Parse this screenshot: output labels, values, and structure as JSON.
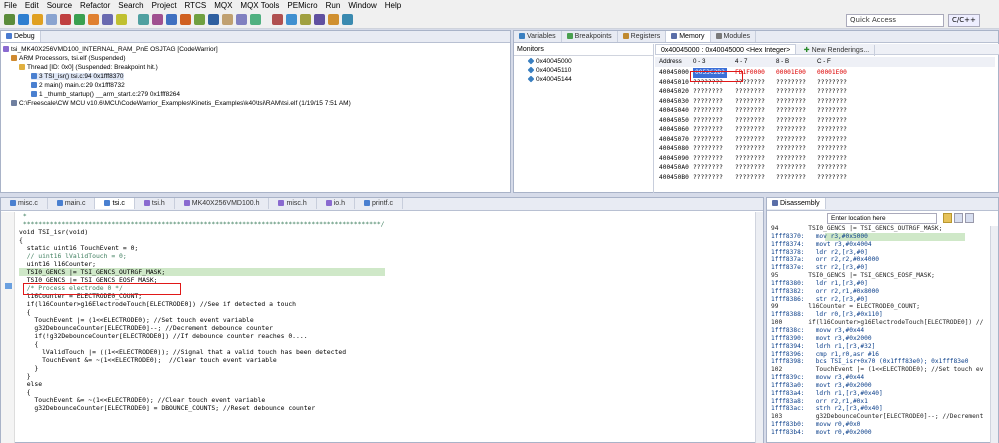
{
  "menu": [
    "File",
    "Edit",
    "Source",
    "Refactor",
    "Search",
    "Project",
    "RTCS",
    "MQX",
    "MQX Tools",
    "PEMicro",
    "Run",
    "Window",
    "Help"
  ],
  "toolbar": {
    "quick_access": "Quick Access",
    "perspective": "C/C++"
  },
  "debug": {
    "tab": "Debug",
    "tree": [
      "tsi_MK40X256VMD100_INTERNAL_RAM_PnE OSJTAG [CodeWarrior]",
      "ARM Processors, tsi.elf (Suspended)",
      "Thread [ID: 0x0] (Suspended: Breakpoint hit.)",
      "3 TSI_isr() tsi.c:94 0x1fff8370",
      "2 main() main.c:29 0x1fff8732",
      "1 _thumb_startup() __arm_start.c:279 0x1fff8264",
      "C:\\Freescale\\CW MCU v10.6\\MCU\\CodeWarrior_Examples\\Kinetis_Examples\\k40\\tsi\\RAM\\tsi.elf (1/19/15 7:51 AM)"
    ]
  },
  "memory": {
    "tabs": [
      "Variables",
      "Breakpoints",
      "Registers",
      "Memory",
      "Modules"
    ],
    "monitors_label": "Monitors",
    "monitors": [
      "0x40045000",
      "0x40045110",
      "0x40045144"
    ],
    "rendering_tab": "0x40045000 : 0x40045000 <Hex Integer>",
    "new_renderings": "New Renderings...",
    "columns": [
      "Address",
      "0 - 3",
      "4 - 7",
      "8 - B",
      "C - F"
    ],
    "rows": [
      {
        "addr": "40045000",
        "c0": "0053C2D2",
        "c1": "FD1F0000",
        "c2": "00001E00",
        "c3": "00001E00"
      },
      {
        "addr": "40045010",
        "c0": "????????",
        "c1": "????????",
        "c2": "????????",
        "c3": "????????"
      },
      {
        "addr": "40045020",
        "c0": "????????",
        "c1": "????????",
        "c2": "????????",
        "c3": "????????"
      },
      {
        "addr": "40045030",
        "c0": "????????",
        "c1": "????????",
        "c2": "????????",
        "c3": "????????"
      },
      {
        "addr": "40045040",
        "c0": "????????",
        "c1": "????????",
        "c2": "????????",
        "c3": "????????"
      },
      {
        "addr": "40045050",
        "c0": "????????",
        "c1": "????????",
        "c2": "????????",
        "c3": "????????"
      },
      {
        "addr": "40045060",
        "c0": "????????",
        "c1": "????????",
        "c2": "????????",
        "c3": "????????"
      },
      {
        "addr": "40045070",
        "c0": "????????",
        "c1": "????????",
        "c2": "????????",
        "c3": "????????"
      },
      {
        "addr": "40045080",
        "c0": "????????",
        "c1": "????????",
        "c2": "????????",
        "c3": "????????"
      },
      {
        "addr": "40045090",
        "c0": "????????",
        "c1": "????????",
        "c2": "????????",
        "c3": "????????"
      },
      {
        "addr": "400450A0",
        "c0": "????????",
        "c1": "????????",
        "c2": "????????",
        "c3": "????????"
      },
      {
        "addr": "400450B0",
        "c0": "????????",
        "c1": "????????",
        "c2": "????????",
        "c3": "????????"
      }
    ]
  },
  "editor": {
    "tabs": [
      "misc.c",
      "main.c",
      "tsi.c",
      "tsi.h",
      "MK40X256VMD100.h",
      "misc.h",
      "io.h",
      "printf.c"
    ],
    "active_tab": "tsi.c",
    "lines": [
      " *",
      " *********************************************************************************************/",
      "",
      "void TSI_isr(void)",
      "{",
      "  static uint16 TouchEvent = 0;",
      "  // uint16 lValidTouch = 0;",
      "  uint16 l16Counter;",
      "",
      "  TSI0_GENCS |= TSI_GENCS_OUTRGF_MASK;",
      "  TSI0_GENCS |= TSI_GENCS_EOSF_MASK;",
      "",
      "",
      "  /* Process electrode 0 */",
      "  l16Counter = ELECTRODE0_COUNT;",
      "  if(l16Counter>g16ElectrodeTouch[ELECTRODE0]) //See if detected a touch",
      "  {",
      "    TouchEvent |= (1<<ELECTRODE0); //Set touch event variable",
      "    g32DebounceCounter[ELECTRODE0]--; //Decrement debounce counter",
      "    if(!g32DebounceCounter[ELECTRODE0]) //If debounce counter reaches 0....",
      "    {",
      "      lValidTouch |= ((1<<ELECTRODE0)); //Signal that a valid touch has been detected",
      "      TouchEvent &= ~(1<<ELECTRODE0);  //Clear touch event variable",
      "    }",
      "  }",
      "  else",
      "  {",
      "    TouchEvent &= ~(1<<ELECTRODE0); //Clear touch event variable",
      "    g32DebounceCounter[ELECTRODE0] = DBOUNCE_COUNTS; //Reset debounce counter"
    ]
  },
  "disassembly": {
    "tab": "Disassembly",
    "location_placeholder": "Enter location here",
    "lines": [
      "94        TSI0_GENCS |= TSI_GENCS_OUTRGF_MASK;",
      "1fff8370:   mov r3,#0x5000",
      "1fff8374:   movt r3,#0x4004",
      "1fff8378:   ldr r2,[r3,#0]",
      "1fff837a:   orr r2,r2,#0x4000",
      "1fff837e:   str r2,[r3,#0]",
      "95        TSI0_GENCS |= TSI_GENCS_EOSF_MASK;",
      "1fff8380:   ldr r1,[r3,#0]",
      "1fff8382:   orr r2,r1,#0x8000",
      "1fff8386:   str r2,[r3,#0]",
      "99        l16Counter = ELECTRODE0_COUNT;",
      "1fff8388:   ldr r0,[r3,#0x110]",
      "100       if(l16Counter>g16ElectrodeTouch[ELECTRODE0]) //",
      "1fff838c:   movw r3,#0x44",
      "1fff8390:   movt r3,#0x2000",
      "1fff8394:   ldrh r1,[r3,#32]",
      "1fff8396:   cmp r1,r0,asr #16",
      "1fff8398:   bcs TSI_isr+0x70 (0x1fff83e0); 0x1fff83e0",
      "102         TouchEvent |= (1<<ELECTRODE0); //Set touch ev",
      "1fff839c:   movw r3,#0x44",
      "1fff83a0:   movt r3,#0x2000",
      "1fff83a4:   ldrh r1,[r3,#0x40]",
      "1fff83a8:   orr r2,r1,#0x1",
      "1fff83ac:   strh r2,[r3,#0x40]",
      "103         g32DebounceCounter[ELECTRODE0]--; //Decrement",
      "1fff83b0:   movw r0,#0x0",
      "1fff83b4:   movt r0,#0x2000"
    ]
  }
}
